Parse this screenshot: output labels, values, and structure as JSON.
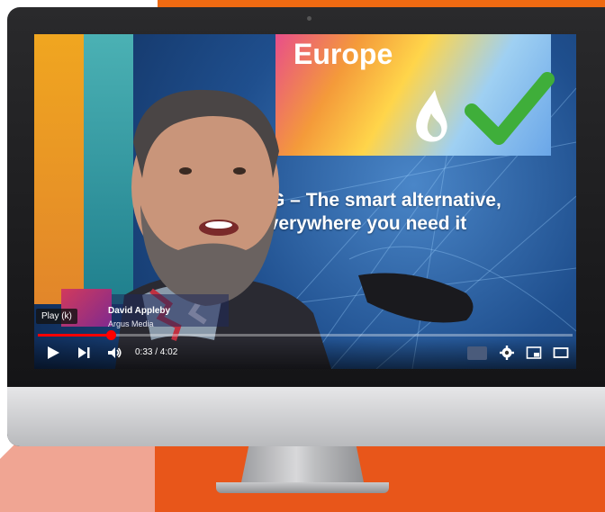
{
  "video": {
    "banner_title": "Europe",
    "tagline": "PG – The smart alternative, everywhere you need it",
    "lower_third_name": "David Appleby",
    "lower_third_org": "Argus Media"
  },
  "player": {
    "tooltip": "Play (k)",
    "time_display": "0:33 / 4:02",
    "progress_fraction": 0.137,
    "accent_color": "#ff0000",
    "controls_left": [
      "play-icon",
      "next-icon",
      "volume-icon"
    ],
    "controls_right": [
      "subtitles-icon",
      "settings-icon",
      "miniplayer-icon",
      "theater-icon"
    ]
  },
  "colors": {
    "background_orange": "#ef6a12",
    "background_pink": "#f0a593",
    "check_green": "#3fae3a"
  }
}
